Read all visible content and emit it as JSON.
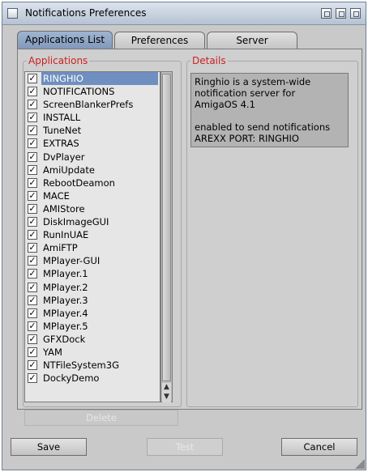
{
  "window": {
    "title": "Notifications Preferences"
  },
  "tabs": [
    {
      "label": "Applications List",
      "active": true
    },
    {
      "label": "Preferences",
      "active": false
    },
    {
      "label": "Server",
      "active": false
    }
  ],
  "applications": {
    "group_label": "Applications",
    "items": [
      {
        "label": "RINGHIO",
        "checked": true,
        "selected": true
      },
      {
        "label": "NOTIFICATIONS",
        "checked": true
      },
      {
        "label": "ScreenBlankerPrefs",
        "checked": true
      },
      {
        "label": "INSTALL",
        "checked": true
      },
      {
        "label": "TuneNet",
        "checked": true
      },
      {
        "label": "EXTRAS",
        "checked": true
      },
      {
        "label": "DvPlayer",
        "checked": true
      },
      {
        "label": "AmiUpdate",
        "checked": true
      },
      {
        "label": "RebootDeamon",
        "checked": true
      },
      {
        "label": "MACE",
        "checked": true
      },
      {
        "label": "AMIStore",
        "checked": true
      },
      {
        "label": "DiskImageGUI",
        "checked": true
      },
      {
        "label": "RunInUAE",
        "checked": true
      },
      {
        "label": "AmiFTP",
        "checked": true
      },
      {
        "label": "MPlayer-GUI",
        "checked": true
      },
      {
        "label": "MPlayer.1",
        "checked": true
      },
      {
        "label": "MPlayer.2",
        "checked": true
      },
      {
        "label": "MPlayer.3",
        "checked": true
      },
      {
        "label": "MPlayer.4",
        "checked": true
      },
      {
        "label": "MPlayer.5",
        "checked": true
      },
      {
        "label": "GFXDock",
        "checked": true
      },
      {
        "label": "YAM",
        "checked": true
      },
      {
        "label": "NTFileSystem3G",
        "checked": true
      },
      {
        "label": "DockyDemo",
        "checked": true
      }
    ],
    "delete_label": "Delete"
  },
  "details": {
    "group_label": "Details",
    "line1": "Ringhio is a system-wide",
    "line2": "notification server for",
    "line3": "AmigaOS 4.1",
    "line4": "enabled to send notifications",
    "line5": "AREXX PORT: RINGHIO"
  },
  "buttons": {
    "save": "Save",
    "test": "Test",
    "cancel": "Cancel"
  },
  "colors": {
    "selection": "#6e8fbf",
    "group_label": "#cc1f1f"
  }
}
